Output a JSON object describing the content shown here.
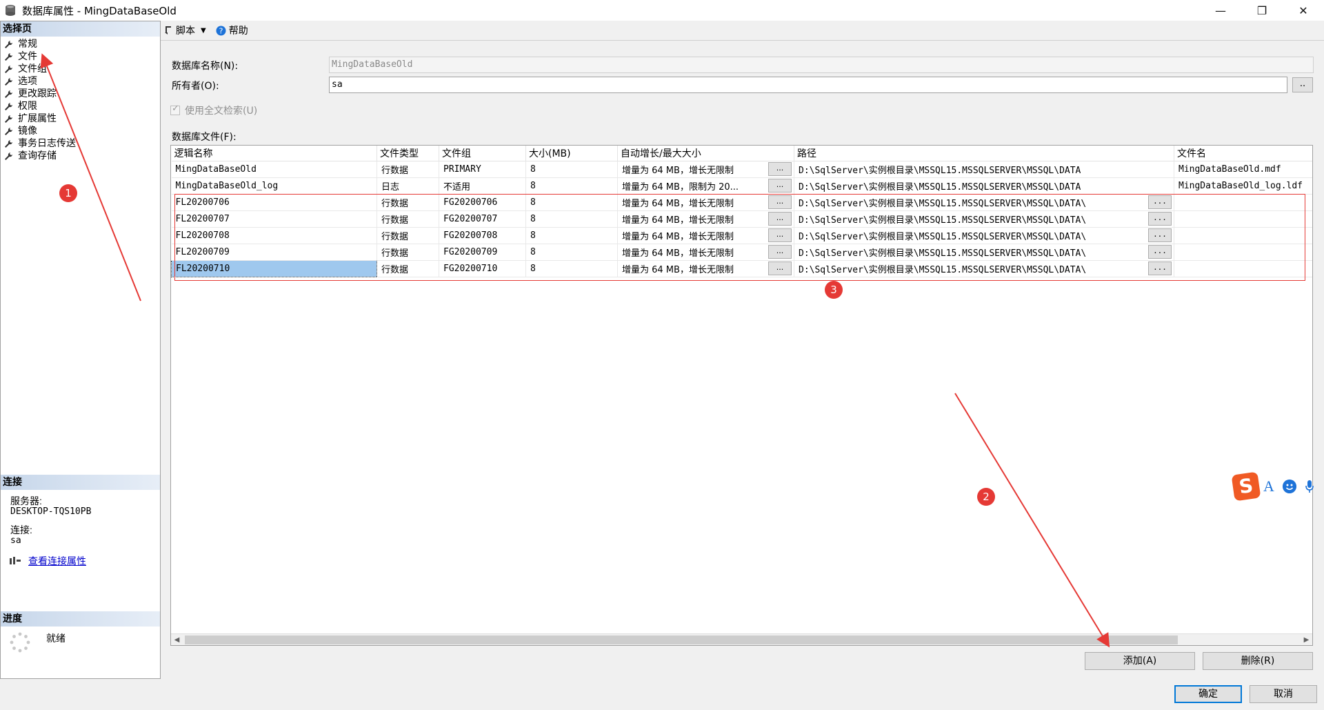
{
  "window": {
    "title": "数据库属性 - MingDataBaseOld",
    "min_glyph": "—",
    "max_glyph": "❐",
    "close_glyph": "✕"
  },
  "left_panel": {
    "pages_header": "选择页",
    "pages": [
      "常规",
      "文件",
      "文件组",
      "选项",
      "更改跟踪",
      "权限",
      "扩展属性",
      "镜像",
      "事务日志传送",
      "查询存储"
    ],
    "connection_header": "连接",
    "server_label": "服务器:",
    "server_value": "DESKTOP-TQS10PB",
    "connection_label": "连接:",
    "connection_value": "sa",
    "view_conn_link": "查看连接属性",
    "progress_header": "进度",
    "progress_status": "就绪"
  },
  "toolbar": {
    "script_label": "脚本",
    "caret": "▼",
    "help_label": "帮助"
  },
  "form": {
    "db_name_label": "数据库名称(N):",
    "db_name_value": "MingDataBaseOld",
    "owner_label": "所有者(O):",
    "owner_value": "sa",
    "owner_browse": "..",
    "fulltext_label": "使用全文检索(U)",
    "db_files_label": "数据库文件(F):"
  },
  "grid": {
    "columns": [
      "逻辑名称",
      "文件类型",
      "文件组",
      "大小(MB)",
      "自动增长/最大大小",
      "路径",
      "文件名"
    ],
    "browse_glyph": "...",
    "rows": [
      {
        "name": "MingDataBaseOld",
        "type": "行数据",
        "group": "PRIMARY",
        "size": "8",
        "growth": "增量为 64 MB，增长无限制",
        "path": "D:\\SqlServer\\实例根目录\\MSSQL15.MSSQLSERVER\\MSSQL\\DATA",
        "file": "MingDataBaseOld.mdf"
      },
      {
        "name": "MingDataBaseOld_log",
        "type": "日志",
        "group": "不适用",
        "size": "8",
        "growth": "增量为 64 MB，限制为 20...",
        "path": "D:\\SqlServer\\实例根目录\\MSSQL15.MSSQLSERVER\\MSSQL\\DATA",
        "file": "MingDataBaseOld_log.ldf"
      },
      {
        "name": "FL20200706",
        "type": "行数据",
        "group": "FG20200706",
        "size": "8",
        "growth": "增量为 64 MB，增长无限制",
        "path": "D:\\SqlServer\\实例根目录\\MSSQL15.MSSQLSERVER\\MSSQL\\DATA\\",
        "file": ""
      },
      {
        "name": "FL20200707",
        "type": "行数据",
        "group": "FG20200707",
        "size": "8",
        "growth": "增量为 64 MB，增长无限制",
        "path": "D:\\SqlServer\\实例根目录\\MSSQL15.MSSQLSERVER\\MSSQL\\DATA\\",
        "file": ""
      },
      {
        "name": "FL20200708",
        "type": "行数据",
        "group": "FG20200708",
        "size": "8",
        "growth": "增量为 64 MB，增长无限制",
        "path": "D:\\SqlServer\\实例根目录\\MSSQL15.MSSQLSERVER\\MSSQL\\DATA\\",
        "file": ""
      },
      {
        "name": "FL20200709",
        "type": "行数据",
        "group": "FG20200709",
        "size": "8",
        "growth": "增量为 64 MB，增长无限制",
        "path": "D:\\SqlServer\\实例根目录\\MSSQL15.MSSQLSERVER\\MSSQL\\DATA\\",
        "file": ""
      },
      {
        "name": "FL20200710",
        "type": "行数据",
        "group": "FG20200710",
        "size": "8",
        "growth": "增量为 64 MB，增长无限制",
        "path": "D:\\SqlServer\\实例根目录\\MSSQL15.MSSQLSERVER\\MSSQL\\DATA\\",
        "file": ""
      }
    ],
    "scroll_left": "◀",
    "scroll_right": "▶"
  },
  "buttons": {
    "add": "添加(A)",
    "remove": "删除(R)",
    "ok": "确定",
    "cancel": "取消"
  },
  "annotations": {
    "badge1": "1",
    "badge2": "2",
    "badge3": "3",
    "color": "#e53935"
  },
  "ime": {
    "logo": "S",
    "letter": "A"
  }
}
